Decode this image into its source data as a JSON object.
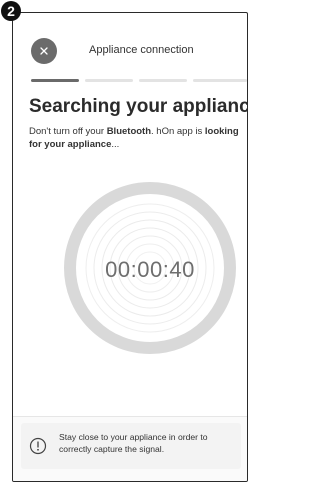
{
  "step_badge": "2",
  "header": {
    "title": "Appliance connection",
    "close_icon": "close-icon"
  },
  "progress": {
    "total_steps": 4,
    "current_step": 1
  },
  "headline": "Searching your appliance",
  "description": {
    "part1": "Don't turn off your ",
    "bold1": "Bluetooth",
    "part2": ". hOn app is ",
    "bold2": "looking for your appliance",
    "part3": "..."
  },
  "timer": {
    "value": "00:00:40",
    "ring_color": "#d9d9d9"
  },
  "footer": {
    "icon": "info-icon",
    "hint": "Stay close to your appliance in order to correctly capture the signal."
  }
}
